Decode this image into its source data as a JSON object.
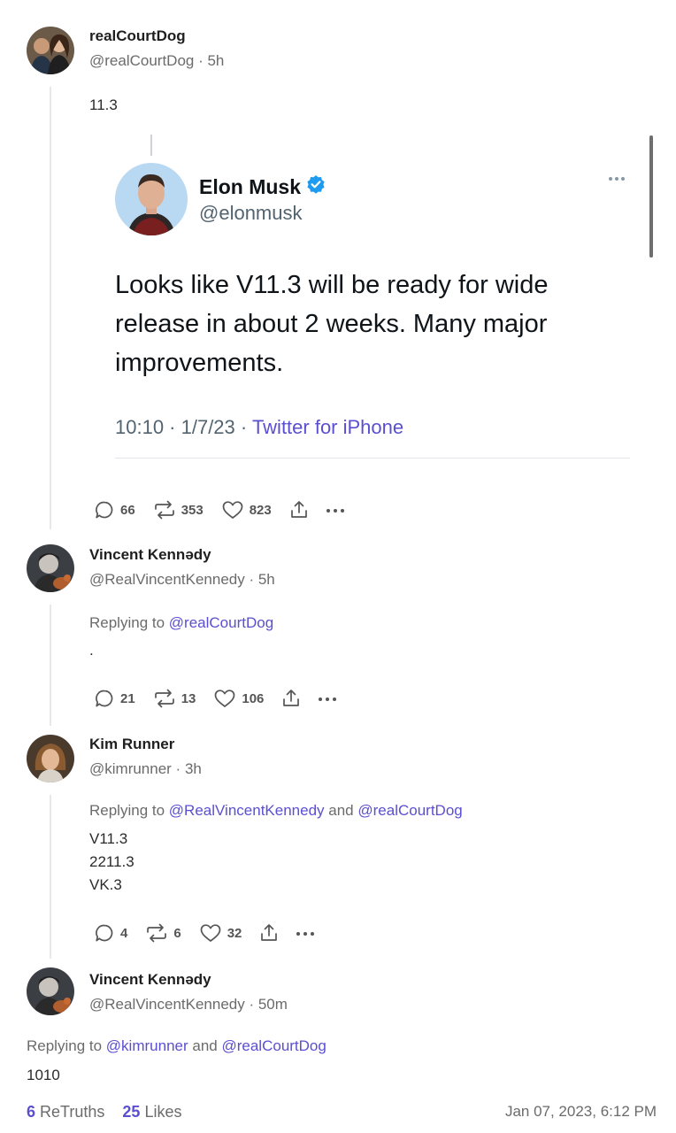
{
  "posts": [
    {
      "name": "realCourtDog",
      "handle": "@realCourtDog · 5h",
      "text": "11.3",
      "quoted": {
        "name": "Elon Musk",
        "handle": "@elonmusk",
        "text": "Looks like V11.3 will be ready for wide release in about 2 weeks. Many major improvements.",
        "time": "10:10 · 1/7/23 ·",
        "source": "Twitter for iPhone"
      },
      "actions": {
        "replies": "66",
        "retruths": "353",
        "likes": "823"
      }
    },
    {
      "name": "Vincent Kennədy",
      "handle": "@RealVincentKennedy · 5h",
      "replying_prefix": "Replying to",
      "replying_to_1": "@realCourtDog",
      "text": ".",
      "actions": {
        "replies": "21",
        "retruths": "13",
        "likes": "106"
      }
    },
    {
      "name": "Kim Runner",
      "handle": "@kimrunner · 3h",
      "replying_prefix": "Replying to",
      "replying_to_1": "@RealVincentKennedy",
      "replying_and": "and",
      "replying_to_2": "@realCourtDog",
      "text": "V11.3\n2211.3\nVK.3",
      "actions": {
        "replies": "4",
        "retruths": "6",
        "likes": "32"
      }
    },
    {
      "name": "Vincent Kennədy",
      "handle": "@RealVincentKennedy · 50m",
      "replying_prefix": "Replying to",
      "replying_to_1": "@kimrunner",
      "replying_and": "and",
      "replying_to_2": "@realCourtDog",
      "text": "1010"
    }
  ],
  "footer": {
    "retruths_count": "6",
    "retruths_label": "ReTruths",
    "likes_count": "25",
    "likes_label": "Likes",
    "date": "Jan 07, 2023, 6:12 PM"
  },
  "colors": {
    "mention": "#5b4fd1",
    "verified": "#1d9bf0",
    "muted": "#6b6b6b"
  }
}
